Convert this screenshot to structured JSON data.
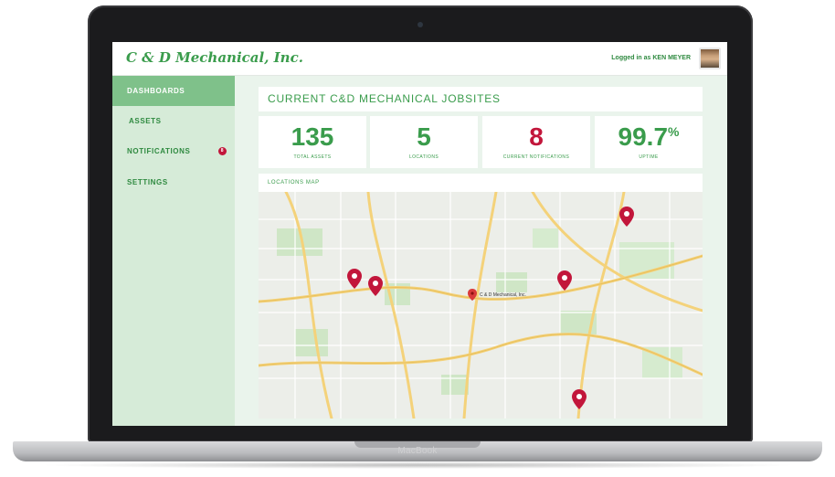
{
  "device": {
    "brand": "MacBook"
  },
  "app": {
    "logo_text": "C & D Mechanical, Inc.",
    "user_label": "Logged in as KEN MEYER"
  },
  "sidebar": {
    "items": [
      {
        "label": "DASHBOARDS",
        "active": true
      },
      {
        "label": "ASSETS",
        "active": false
      },
      {
        "label": "NOTIFICATIONS",
        "active": false,
        "badge": "8"
      },
      {
        "label": "SETTINGS",
        "active": false
      }
    ]
  },
  "main": {
    "title": "CURRENT C&D MECHANICAL JOBSITES",
    "stats": [
      {
        "value": "135",
        "label": "TOTAL ASSETS"
      },
      {
        "value": "5",
        "label": "LOCATIONS"
      },
      {
        "value": "8",
        "label": "CURRENT NOTIFICATIONS"
      },
      {
        "value": "99.7",
        "suffix": "%",
        "label": "UPTIME"
      }
    ],
    "map": {
      "header": "LOCATIONS MAP",
      "hq_label": "C & D Mechanical, Inc.",
      "marker_count": 5
    }
  },
  "colors": {
    "brand_green": "#3a9c4c",
    "sidebar_bg": "#d6ebd8",
    "active_nav": "#7fc18a",
    "alert_red": "#c2163b",
    "page_bg": "#eaf4ec"
  },
  "icons": {
    "marker": "map-pin-icon",
    "hq": "map-pin-small-icon"
  }
}
